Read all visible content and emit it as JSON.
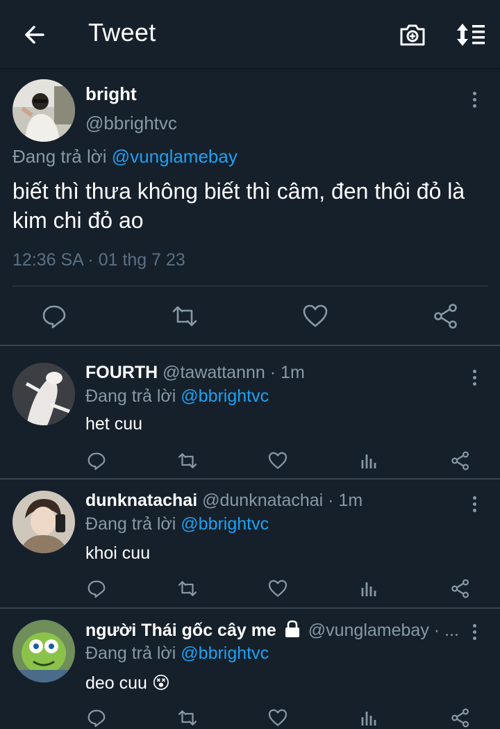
{
  "header": {
    "title": "Tweet",
    "back_icon": "arrow-left-icon",
    "camera_icon": "camera-add-icon",
    "sort_icon": "sort-list-icon"
  },
  "main_tweet": {
    "name": "bright",
    "handle": "@bbrightvc",
    "replying_prefix": "Đang trả lời",
    "replying_to": "@vunglamebay",
    "text": "biết thì thưa không biết thì câm, đen thôi đỏ là kim chi đỏ ao",
    "timestamp": "12:36 SA · 01 thg 7 23"
  },
  "replies": [
    {
      "name": "FOURTH",
      "handle": "@tawattannn",
      "time": "· 1m",
      "replying_prefix": "Đang trả lời",
      "replying_to": "@bbrightvc",
      "text": "het cuu"
    },
    {
      "name": "dunknatachai",
      "handle": "@dunknatachai",
      "time": "· 1m",
      "replying_prefix": "Đang trả lời",
      "replying_to": "@bbrightvc",
      "text": "khoi cuu"
    },
    {
      "name": "người Thái gốc cây me",
      "handle": "@vunglamebay",
      "time": "· ...",
      "replying_prefix": "Đang trả lời",
      "replying_to": "@bbrightvc",
      "text": "deo cuu 😵"
    }
  ],
  "colors": {
    "background": "#15202b",
    "link": "#1da1f2",
    "secondary_text": "#8899a6",
    "divider": "#38444d"
  }
}
